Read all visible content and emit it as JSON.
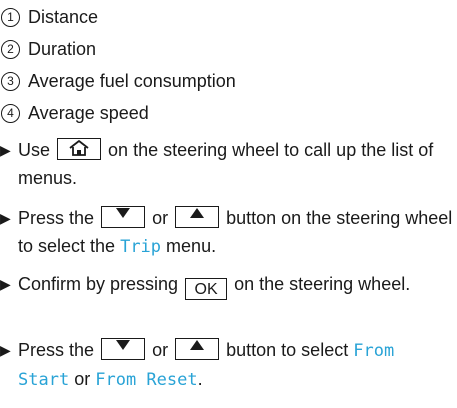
{
  "legend": [
    {
      "num": "1",
      "label": "Distance"
    },
    {
      "num": "2",
      "label": "Duration"
    },
    {
      "num": "3",
      "label": "Average fuel consumption"
    },
    {
      "num": "4",
      "label": "Average speed"
    }
  ],
  "steps": {
    "s1": {
      "a": "Use",
      "b": "on the steering wheel to call up the list of menus.",
      "key_icon": "home-icon"
    },
    "s2": {
      "a": "Press the",
      "b": "or",
      "c": "button on the steering wheel to select the",
      "d": "Trip",
      "e": "menu.",
      "key1_icon": "down-triangle-icon",
      "key2_icon": "up-triangle-icon"
    },
    "s3": {
      "a": "Confirm by pressing",
      "key": "OK",
      "b": "on the steering wheel."
    },
    "s4": {
      "a": "Press the",
      "b": "or",
      "c": "button to select",
      "d": "From Start",
      "e": "or",
      "f": "From Reset",
      "g": ".",
      "key1_icon": "down-triangle-icon",
      "key2_icon": "up-triangle-icon"
    }
  },
  "colors": {
    "menu_text": "#29a3d6",
    "text": "#1a1a1a"
  }
}
